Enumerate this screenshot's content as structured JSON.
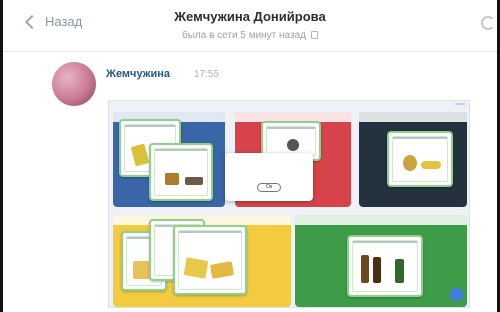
{
  "header": {
    "back_label": "Назад",
    "title": "Жемчужина Донийрова",
    "status": "была в сети 5 минут назад"
  },
  "message": {
    "sender": "Жемчужина",
    "time": "17:55"
  },
  "attachment": {
    "dialog_button": "Ок"
  },
  "icons": {
    "back": "chevron-left-icon",
    "lock": "lock-icon",
    "right": "refresh-icon"
  },
  "colors": {
    "link": "#2a5885",
    "bin_blue": "#3a66a7",
    "bin_red": "#d7434a",
    "bin_dark": "#24313f",
    "bin_yellow": "#f2cb40",
    "bin_green": "#3e9b48",
    "card_border": "#8fd08a"
  }
}
